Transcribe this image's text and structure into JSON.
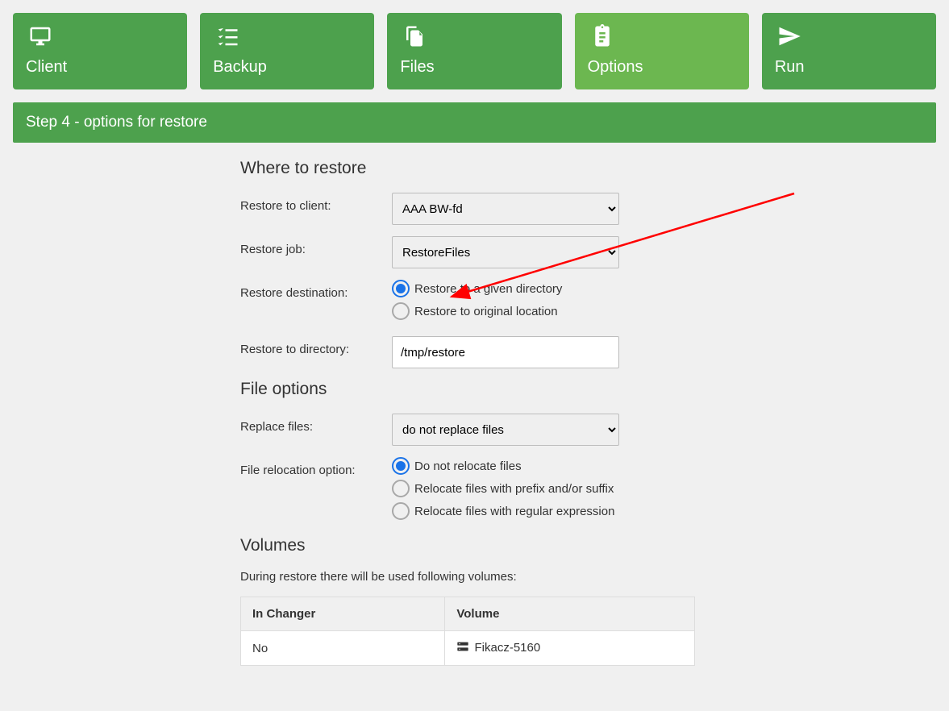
{
  "steps": {
    "client": "Client",
    "backup": "Backup",
    "files": "Files",
    "options": "Options",
    "run": "Run"
  },
  "step_title": "Step 4 - options for restore",
  "sections": {
    "where": "Where to restore",
    "file_options": "File options",
    "volumes": "Volumes"
  },
  "labels": {
    "restore_to_client": "Restore to client:",
    "restore_job": "Restore job:",
    "restore_destination": "Restore destination:",
    "restore_to_directory": "Restore to directory:",
    "replace_files": "Replace files:",
    "file_relocation": "File relocation option:"
  },
  "values": {
    "restore_to_client": "AAA BW-fd",
    "restore_job": "RestoreFiles",
    "restore_to_directory": "/tmp/restore",
    "replace_files": "do not replace files"
  },
  "radios": {
    "dest_given": "Restore to a given directory",
    "dest_original": "Restore to original location",
    "reloc_none": "Do not relocate files",
    "reloc_prefix": "Relocate files with prefix and/or suffix",
    "reloc_regex": "Relocate files with regular expression"
  },
  "volumes_desc": "During restore there will be used following volumes:",
  "vol_table": {
    "h_changer": "In Changer",
    "h_volume": "Volume",
    "row1_changer": "No",
    "row1_volume": " Fikacz-5160"
  }
}
